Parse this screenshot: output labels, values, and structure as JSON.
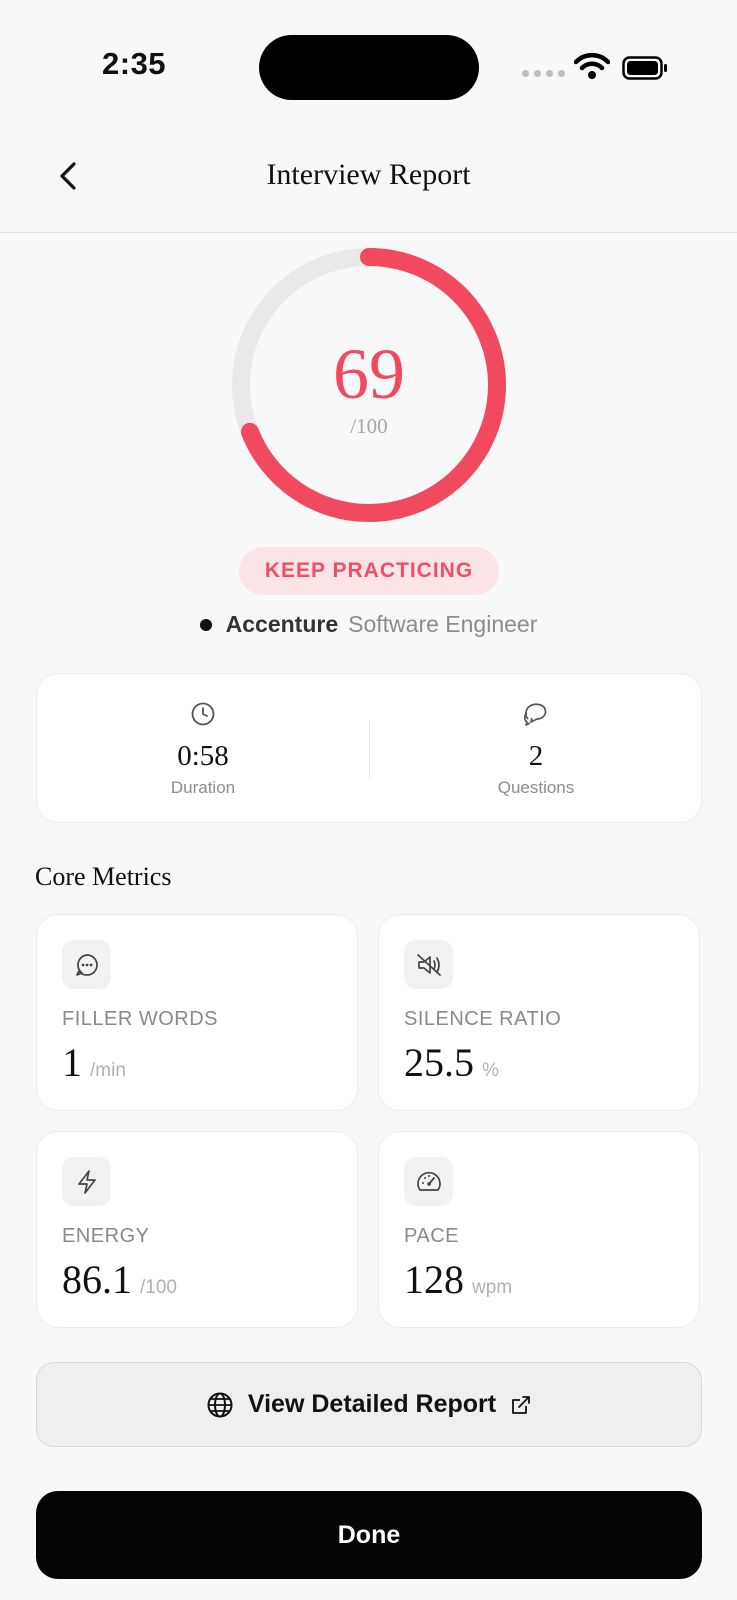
{
  "status_bar": {
    "time": "2:35"
  },
  "nav": {
    "title": "Interview Report"
  },
  "score": {
    "value": "69",
    "max": "/100",
    "fraction": 0.69
  },
  "badge": "KEEP PRACTICING",
  "company": "Accenture",
  "role": "Software Engineer",
  "summary": {
    "duration_value": "0:58",
    "duration_label": "Duration",
    "questions_value": "2",
    "questions_label": "Questions"
  },
  "core_metrics_title": "Core Metrics",
  "metrics": [
    {
      "label": "FILLER WORDS",
      "value": "1",
      "unit": "/min",
      "icon": "chat-bubble-icon"
    },
    {
      "label": "SILENCE RATIO",
      "value": "25.5",
      "unit": "%",
      "icon": "speaker-muted-icon"
    },
    {
      "label": "ENERGY",
      "value": "86.1",
      "unit": "/100",
      "icon": "lightning-icon"
    },
    {
      "label": "PACE",
      "value": "128",
      "unit": "wpm",
      "icon": "speedometer-icon"
    }
  ],
  "buttons": {
    "detailed_report": "View Detailed Report",
    "done": "Done"
  },
  "colors": {
    "accent": "#f14a5f",
    "badge_bg": "#fbe4e6",
    "done_bg": "#050505"
  }
}
